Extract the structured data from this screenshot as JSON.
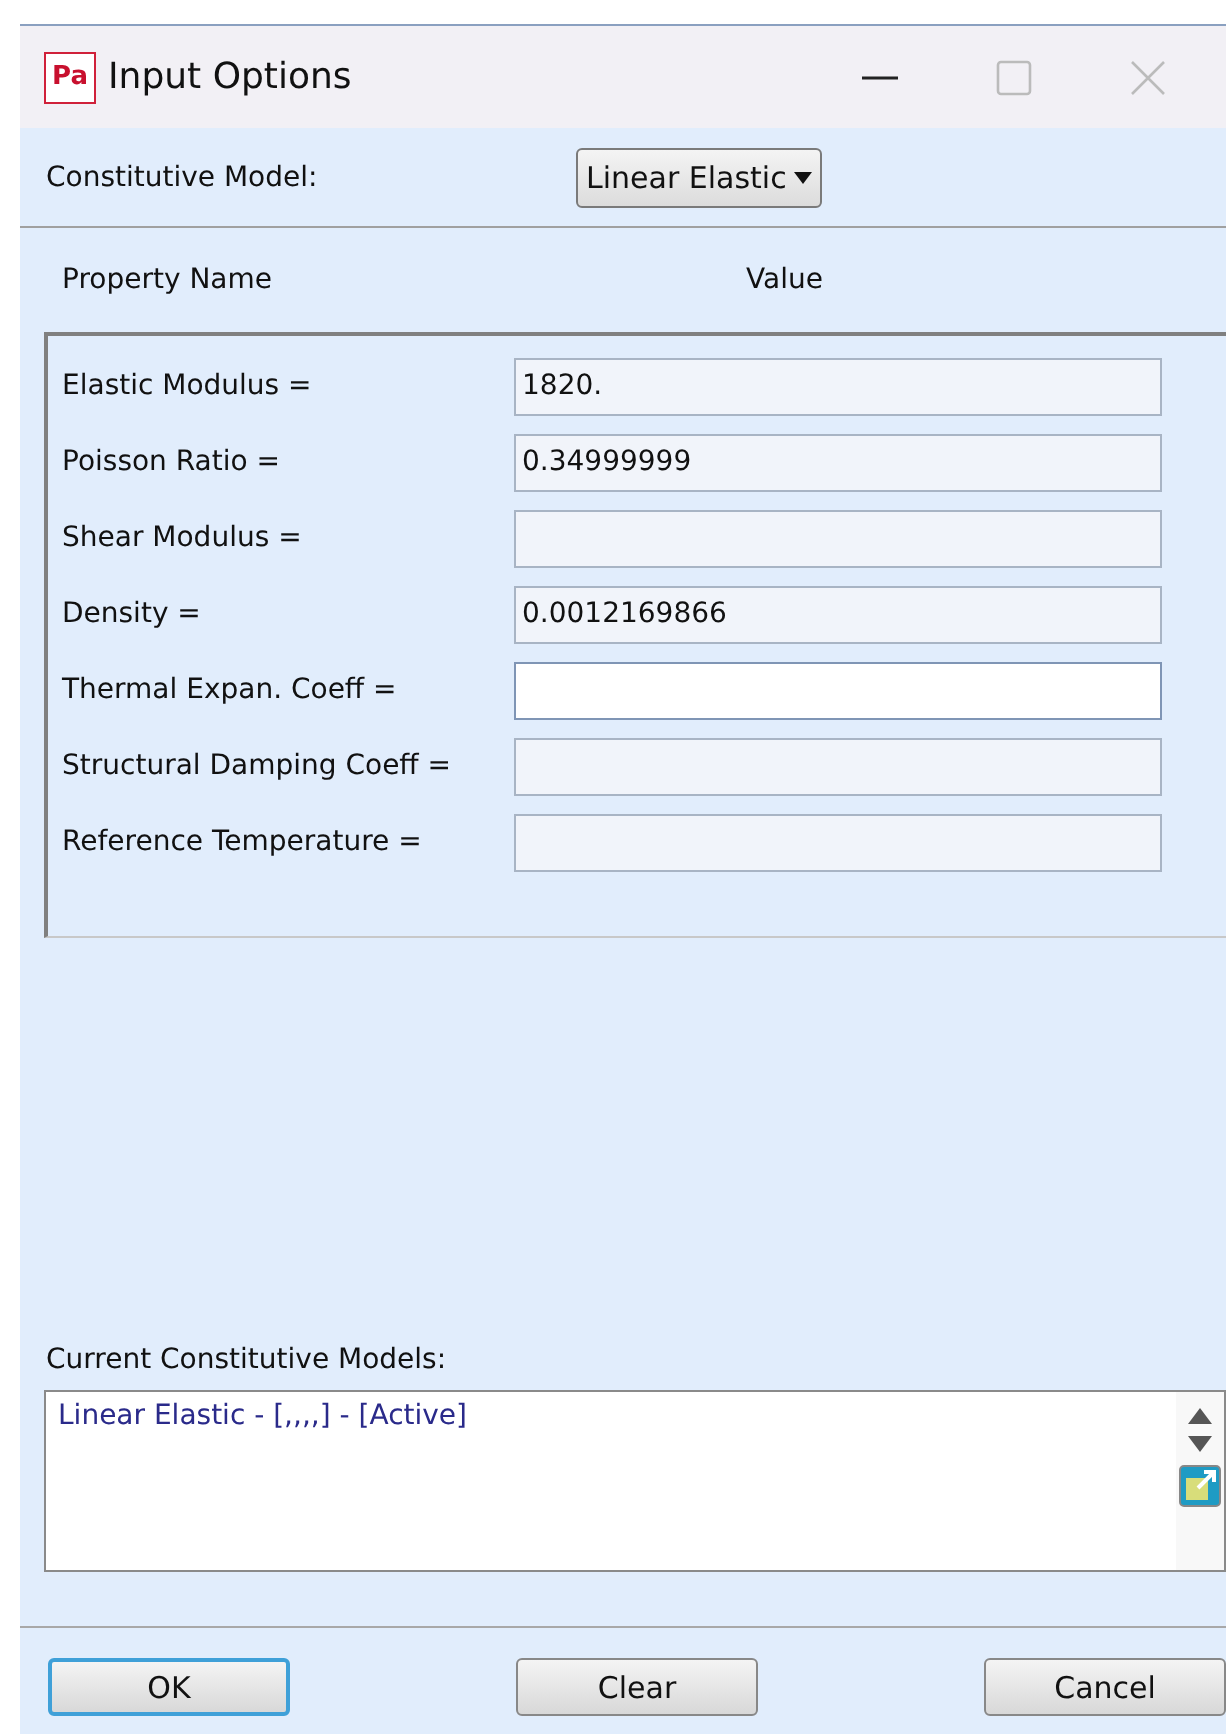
{
  "window": {
    "title": "Input Options",
    "app_icon": "Pa"
  },
  "model": {
    "label": "Constitutive Model:",
    "value": "Linear Elastic"
  },
  "columns": [
    "Property Name",
    "Value"
  ],
  "properties": [
    {
      "label": "Elastic Modulus =",
      "value": "1820.",
      "focused": false
    },
    {
      "label": "Poisson Ratio =",
      "value": "0.34999999",
      "focused": false
    },
    {
      "label": "Shear Modulus =",
      "focused": false
    },
    {
      "label": "Density =",
      "value": "0.0012169866",
      "focused": false
    },
    {
      "label": "Thermal Expan. Coeff =",
      "focused": true
    },
    {
      "label": "Structural Damping Coeff =",
      "focused": false
    },
    {
      "label": "Reference Temperature =",
      "focused": false
    }
  ],
  "current": {
    "label": "Current Constitutive Models:",
    "items": [
      "Linear Elastic - [,,,,] - [Active]"
    ]
  },
  "buttons": [
    {
      "label": "OK",
      "default": true
    },
    {
      "label": "Clear",
      "default": false
    },
    {
      "label": "Cancel",
      "default": false
    }
  ]
}
